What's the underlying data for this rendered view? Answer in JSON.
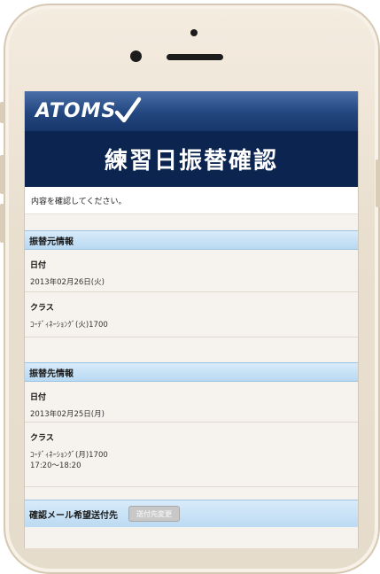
{
  "brand": {
    "name": "ATOMS"
  },
  "title": "練習日振替確認",
  "notice": "内容を確認してください。",
  "source": {
    "heading": "振替元情報",
    "date_label": "日付",
    "date_value": "2013年02月26日(火)",
    "class_label": "クラス",
    "class_value": "ｺｰﾃﾞｨﾈｰｼｮﾝｸﾞ(火)1700"
  },
  "target": {
    "heading": "振替先情報",
    "date_label": "日付",
    "date_value": "2013年02月25日(月)",
    "class_label": "クラス",
    "class_value": "ｺｰﾃﾞｨﾈｰｼｮﾝｸﾞ(月)1700",
    "time_value": "17:20～18:20"
  },
  "mail": {
    "label": "確認メール希望送付先",
    "button_label": "送付先変更"
  },
  "colors": {
    "brand": "#22467f",
    "title_bg": "#0b2550",
    "section": "#bcdaf2"
  }
}
